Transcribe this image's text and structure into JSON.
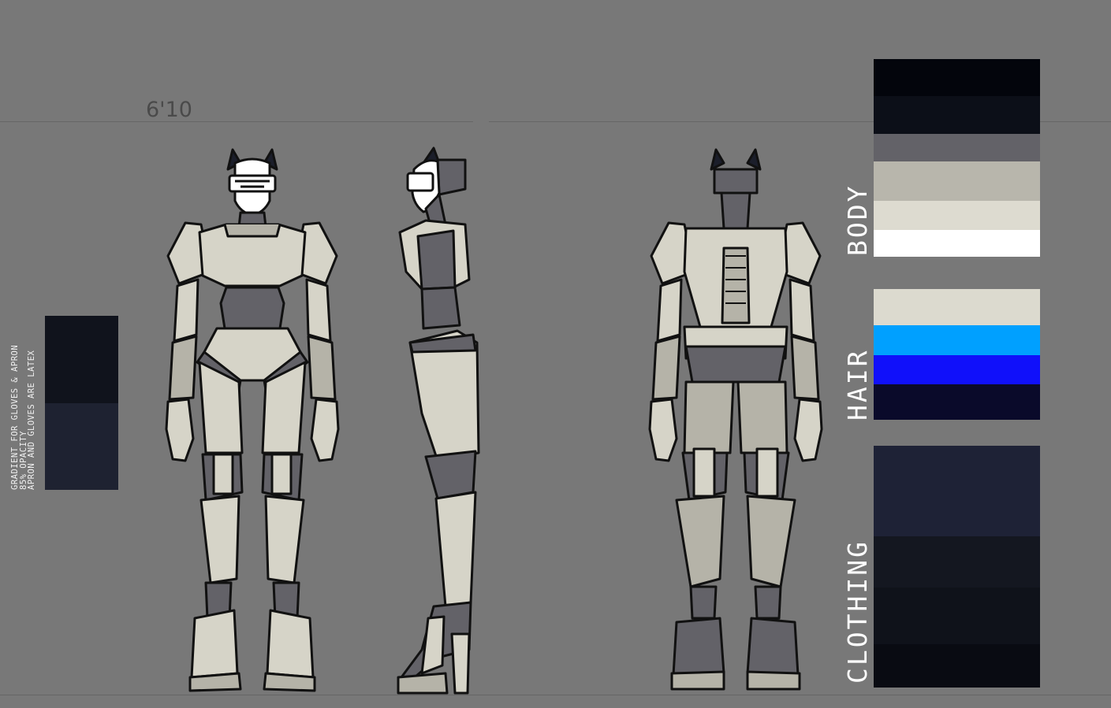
{
  "height_label": "6'10",
  "note": {
    "lines": [
      "GRADIENT FOR GLOVES & APRON",
      "85% OPACITY",
      "APRON AND GLOVES ARE LATEX"
    ],
    "gradient_colors": [
      "#10131c",
      "#1e2231"
    ]
  },
  "palettes": {
    "body": {
      "label": "BODY",
      "colors": [
        "#03050c",
        "#0c0f18",
        "#636268",
        "#b8b6ac",
        "#dddbd0",
        "#ffffff"
      ]
    },
    "hair": {
      "label": "HAIR",
      "colors": [
        "#dcdacf",
        "#00a0ff",
        "#1010fa",
        "#0a0a2a"
      ]
    },
    "clothing": {
      "label": "CLOTHING",
      "colors": [
        "#1e2236",
        "#141720",
        "#0f121a",
        "#090b12"
      ]
    }
  },
  "figure_colors": {
    "light": "#d6d4c8",
    "mid": "#b5b3a8",
    "dark": "#636268",
    "outline": "#111111",
    "visor": "#ffffff",
    "ears": "#1b1e2a"
  },
  "views": [
    "front-view",
    "side-view",
    "back-view"
  ]
}
